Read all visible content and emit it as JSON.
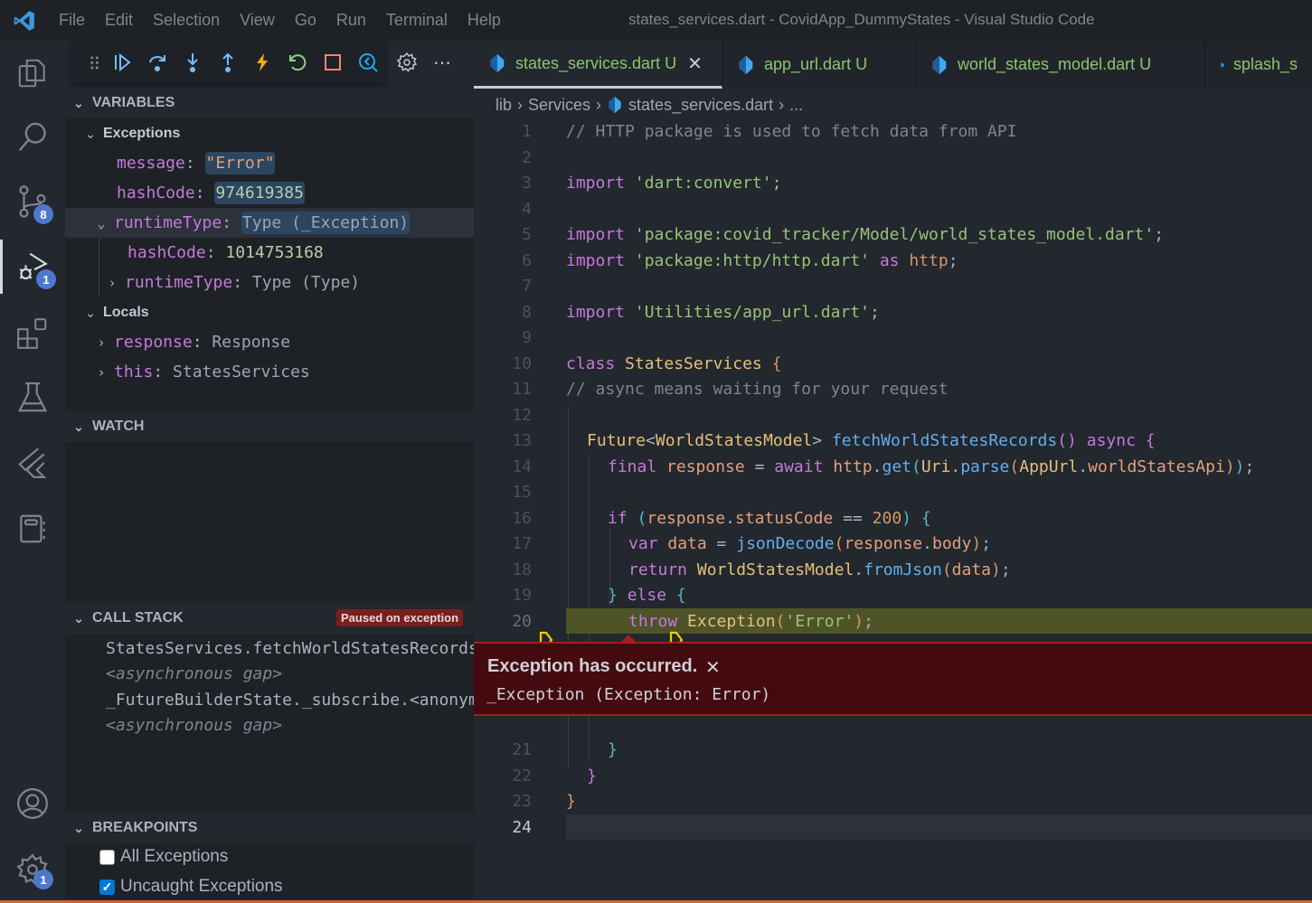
{
  "titlebar": {
    "menu": [
      "File",
      "Edit",
      "Selection",
      "View",
      "Go",
      "Run",
      "Terminal",
      "Help"
    ],
    "title": "states_services.dart - CovidApp_DummyStates - Visual Studio Code"
  },
  "activity_bar": {
    "items": [
      {
        "name": "explorer",
        "icon": "files-icon"
      },
      {
        "name": "search",
        "icon": "search-icon"
      },
      {
        "name": "source-control",
        "icon": "source-control-icon",
        "badge": "8"
      },
      {
        "name": "run-debug",
        "icon": "debug-icon",
        "badge": "1",
        "active": true
      },
      {
        "name": "extensions",
        "icon": "extensions-icon"
      },
      {
        "name": "testing",
        "icon": "flask-icon"
      },
      {
        "name": "flutter",
        "icon": "flutter-icon"
      },
      {
        "name": "notebook",
        "icon": "notebook-icon"
      }
    ],
    "bottom": [
      {
        "name": "accounts",
        "icon": "account-icon"
      },
      {
        "name": "manage",
        "icon": "gear-icon",
        "badge": "1"
      }
    ]
  },
  "debug_toolbar": {
    "buttons": [
      "drag-handle",
      "continue",
      "step-over",
      "step-into",
      "step-out",
      "hot-reload",
      "restart",
      "stop",
      "flutter-inspector"
    ],
    "extra": [
      "settings",
      "more"
    ]
  },
  "sidebar": {
    "variables": {
      "header": "VARIABLES",
      "exceptions_label": "Exceptions",
      "message_name": "message",
      "message_value": "\"Error\"",
      "hashcode_name": "hashCode",
      "hashcode_value": "974619385",
      "runtime_name": "runtimeType",
      "runtime_value": "Type (_Exception)",
      "inner_hash_name": "hashCode",
      "inner_hash_value": "1014753168",
      "inner_runtime_name": "runtimeType",
      "inner_runtime_value": "Type (Type)",
      "locals_label": "Locals",
      "response_name": "response",
      "response_value": "Response",
      "this_name": "this",
      "this_value": "StatesServices"
    },
    "watch": {
      "header": "WATCH"
    },
    "call_stack": {
      "header": "CALL STACK",
      "badge": "Paused on exception",
      "frames": [
        "StatesServices.fetchWorldStatesRecords",
        "<asynchronous gap>",
        "_FutureBuilderState._subscribe.<anonym",
        "<asynchronous gap>"
      ]
    },
    "breakpoints": {
      "header": "BREAKPOINTS",
      "items": [
        {
          "label": "All Exceptions",
          "checked": false
        },
        {
          "label": "Uncaught Exceptions",
          "checked": true
        }
      ]
    }
  },
  "tabs": [
    {
      "label": "states_services.dart",
      "status": "U",
      "active": true
    },
    {
      "label": "app_url.dart",
      "status": "U"
    },
    {
      "label": "world_states_model.dart",
      "status": "U"
    },
    {
      "label": "splash_s",
      "status": ""
    }
  ],
  "breadcrumb": [
    "lib",
    "Services",
    "states_services.dart",
    "..."
  ],
  "editor": {
    "line_numbers": [
      "1",
      "2",
      "3",
      "4",
      "5",
      "6",
      "7",
      "8",
      "9",
      "10",
      "11",
      "12",
      "13",
      "14",
      "15",
      "16",
      "17",
      "18",
      "19",
      "20",
      "21",
      "22",
      "23",
      "24"
    ],
    "current_line": "20",
    "lines": {
      "l1": "// HTTP package is used to fetch data from API",
      "l3_kw": "import",
      "l3_str": "'dart:convert'",
      "l5_kw": "import",
      "l5_str": "'package:covid_tracker/Model/world_states_model.dart'",
      "l6_kw": "import",
      "l6_str": "'package:http/http.dart'",
      "l6_as": "as",
      "l6_alias": "http",
      "l8_kw": "import",
      "l8_str": "'Utilities/app_url.dart'",
      "l10_kw": "class",
      "l10_cls": "StatesServices",
      "l11": "// async means waiting for your request",
      "l13_type": "Future",
      "l13_gen": "WorldStatesModel",
      "l13_fn": "fetchWorldStatesRecords",
      "l13_async": "async",
      "l14_final": "final",
      "l14_var": "response",
      "l14_await": "await",
      "l14_http": "http",
      "l14_get": "get",
      "l14_uri": "Uri",
      "l14_parse": "parse",
      "l14_appurl": "AppUrl",
      "l14_api": "worldStatesApi",
      "l16_if": "if",
      "l16_resp": "response",
      "l16_status": "statusCode",
      "l16_num": "200",
      "l17_var": "var",
      "l17_data": "data",
      "l17_fn": "jsonDecode",
      "l17_resp": "response",
      "l17_body": "body",
      "l18_return": "return",
      "l18_cls": "WorldStatesModel",
      "l18_fn": "fromJson",
      "l18_data": "data",
      "l19_else": "else",
      "l20_throw": "throw",
      "l20_cls": "Exception",
      "l20_str": "'Error'"
    }
  },
  "exception_widget": {
    "title": "Exception has occurred.",
    "message": "_Exception (Exception: Error)"
  },
  "colors": {
    "accent": "#4d78cc",
    "exception_bg": "#430b0f",
    "current_line": "#4f5428",
    "status_bar": "#cc6633"
  }
}
